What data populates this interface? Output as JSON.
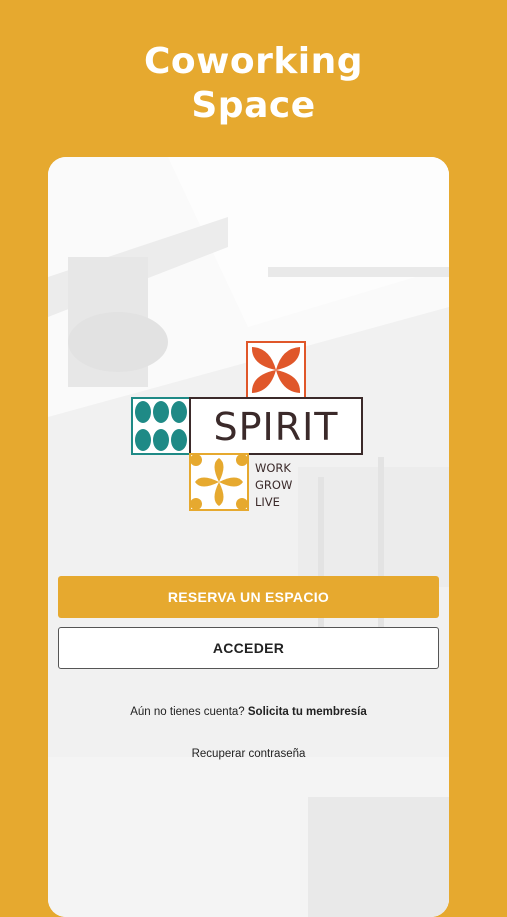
{
  "header": {
    "title_line1": "Coworking",
    "title_line2": "Space"
  },
  "logo": {
    "brand": "SPIRIT",
    "tagline": [
      "WORK",
      "GROW",
      "LIVE"
    ]
  },
  "actions": {
    "reserve_label": "RESERVA UN ESPACIO",
    "login_label": "ACCEDER"
  },
  "signup": {
    "prompt": "Aún no tienes cuenta?",
    "link": "Solicita tu membresía"
  },
  "recover": {
    "link": "Recuperar contraseña"
  },
  "colors": {
    "background": "#E6A92F",
    "accent": "#E6A92F",
    "logo_orange": "#E0572A",
    "logo_teal": "#1F8A86",
    "logo_brown": "#3B2A2A"
  }
}
